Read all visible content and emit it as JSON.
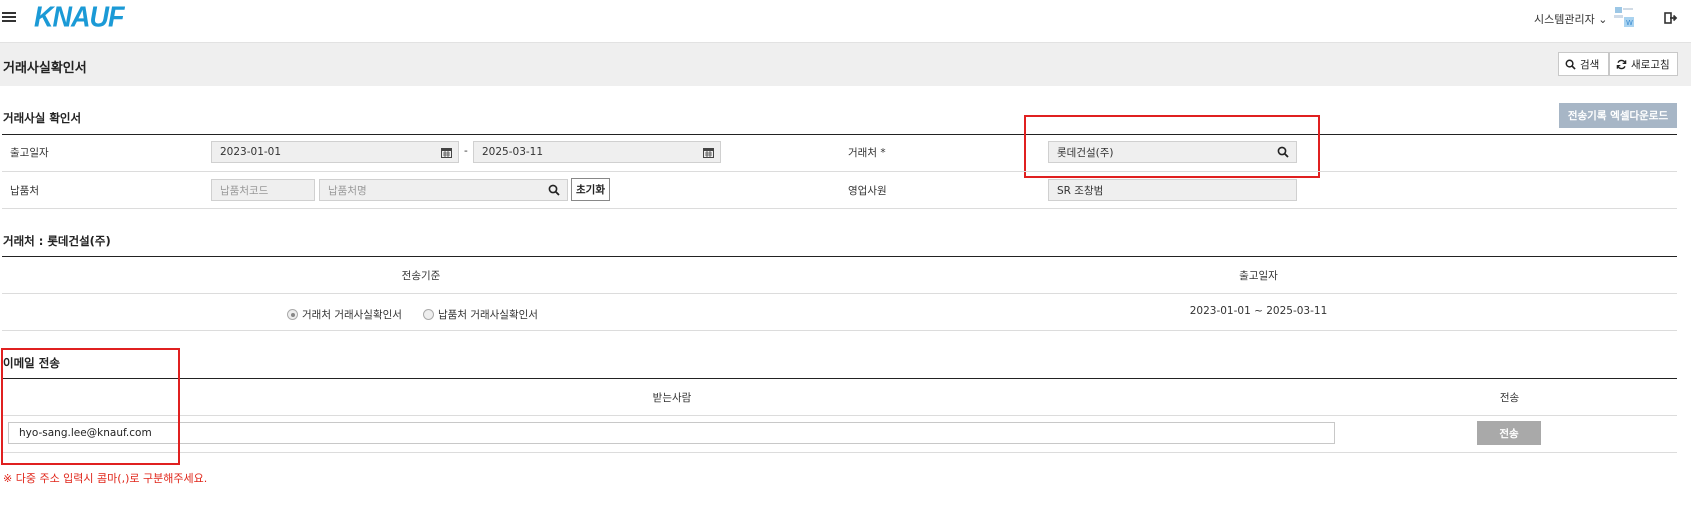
{
  "header": {
    "logo_text": "KNAUF",
    "user_name": "시스템관리자 ⌄"
  },
  "titlebar": {
    "title": "거래사실확인서",
    "search_label": "검색",
    "refresh_label": "새로고침"
  },
  "search_section": {
    "title": "거래사실 확인서",
    "excel_button": "전송기록 엑셀다운로드",
    "ship_date_label": "출고일자",
    "date_from": "2023-01-01",
    "date_sep": "-",
    "date_to": "2025-03-11",
    "customer_label": "거래처 *",
    "customer_value": "롯데건설(주)",
    "delivery_label": "납품처",
    "delivery_code_placeholder": "납품처코드",
    "delivery_name_placeholder": "납품처명",
    "reset_button": "초기화",
    "sales_rep_label": "영업사원",
    "sales_rep_value": "SR 조창범"
  },
  "customer_section": {
    "title": "거래처 : 롯데건설(주)",
    "col_basis": "전송기준",
    "col_date": "출고일자",
    "radio_customer": "거래처 거래사실확인서",
    "radio_delivery": "납품처 거래사실확인서",
    "selected_radio": "customer",
    "date_range": "2023-01-01 ~ 2025-03-11"
  },
  "email_section": {
    "title": "이메일 전송",
    "col_recipient": "받는사람",
    "col_send": "전송",
    "recipient_value": "hyo-sang.lee@knauf.com",
    "send_button": "전송",
    "note": "※ 다중 주소 입력시 콤마(,)로 구분해주세요."
  },
  "colors": {
    "brand": "#1b9ad6",
    "excel_button": "#a7b6c6",
    "send_button": "#a9a9a9",
    "highlight_box": "#e02020",
    "note_text": "#e0261a"
  }
}
